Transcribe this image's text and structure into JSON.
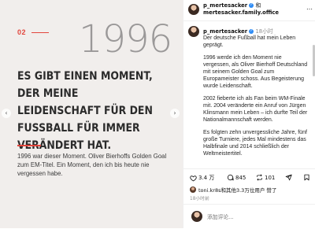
{
  "image": {
    "slide_number": "02",
    "year": "1996",
    "headline": "Es gibt einen Moment, der meine Leidenschaft für den Fussball für immer verändert hat.",
    "caption": "1996 war dieser Moment. Oliver Bierhoffs Golden Goal zum EM-Titel. Ein Moment, den ich bis heute nie vergessen habe.",
    "accent_color": "#e2453c",
    "prev_arrow": "‹",
    "next_arrow": "›"
  },
  "header": {
    "username": "p_mertesacker",
    "conjunction": "和",
    "collaborator": "mertesacker.family.office",
    "more_icon": "…"
  },
  "post": {
    "username": "p_mertesacker",
    "time_ago": "18小时",
    "paragraphs": [
      "Der deutsche Fußball hat mein Leben geprägt.",
      "1996 werde ich den Moment nie vergessen, als Oliver Bierhoff Deutschland mit seinem Golden Goal zum Europameister schoss. Aus Begeisterung wurde Leidenschaft.",
      "2002 fieberte ich als Fan beim WM-Finale mit. 2004 veränderte ein Anruf von Jürgen Klinsmann mein Leben – ich durfte Teil der Nationalmannschaft werden.",
      "Es folgten zehn unvergessliche Jahre, fünf große Turniere, jedes Mal mindestens das Halbfinale und 2014 schließlich der Weltmeistertitel."
    ]
  },
  "actions": {
    "likes": "3.4 万",
    "comments": "845",
    "reposts": "101"
  },
  "liked_by": {
    "text": "toni.kr8s和其他3.3万位用户 赞了"
  },
  "post_time": "18小时前",
  "comment": {
    "placeholder": "添加评论..."
  }
}
